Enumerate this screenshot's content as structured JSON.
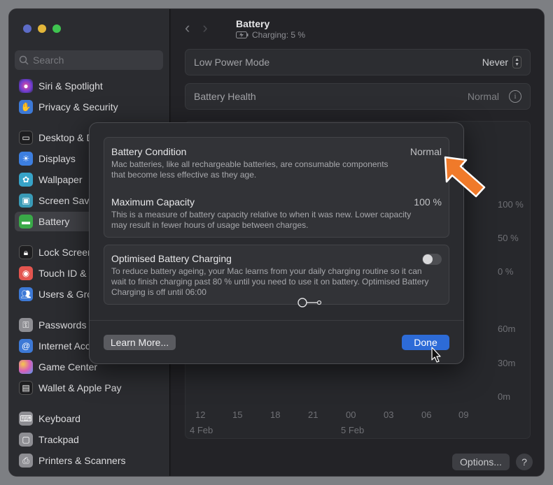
{
  "sidebar": {
    "search_placeholder": "Search",
    "items": [
      {
        "label": "Siri & Spotlight",
        "icon": "siri-icon",
        "color": "#7b3fd1"
      },
      {
        "label": "Privacy & Security",
        "icon": "hand-icon",
        "color": "#3d79d6"
      },
      {
        "label": "Desktop & Dock",
        "icon": "dock-icon",
        "color": "#1e1e20"
      },
      {
        "label": "Displays",
        "icon": "sun-icon",
        "color": "#3d7fe0"
      },
      {
        "label": "Wallpaper",
        "icon": "flower-icon",
        "color": "#37a3c8"
      },
      {
        "label": "Screen Saver",
        "icon": "screensaver-icon",
        "color": "#3a9bb7"
      },
      {
        "label": "Battery",
        "icon": "battery-icon",
        "color": "#39a948"
      },
      {
        "label": "Lock Screen",
        "icon": "lock-icon",
        "color": "#1e1e20"
      },
      {
        "label": "Touch ID & Password",
        "icon": "fingerprint-icon",
        "color": "#e3554f"
      },
      {
        "label": "Users & Groups",
        "icon": "users-icon",
        "color": "#3d79d6"
      },
      {
        "label": "Passwords",
        "icon": "key-icon",
        "color": "#8e8e93"
      },
      {
        "label": "Internet Accounts",
        "icon": "at-icon",
        "color": "#3d79d6"
      },
      {
        "label": "Game Center",
        "icon": "gamecenter-icon",
        "color": "#d95fb7"
      },
      {
        "label": "Wallet & Apple Pay",
        "icon": "wallet-icon",
        "color": "#1e1e20"
      },
      {
        "label": "Keyboard",
        "icon": "keyboard-icon",
        "color": "#8e8e93"
      },
      {
        "label": "Trackpad",
        "icon": "trackpad-icon",
        "color": "#8e8e93"
      },
      {
        "label": "Printers & Scanners",
        "icon": "printer-icon",
        "color": "#8e8e93"
      }
    ]
  },
  "header": {
    "title": "Battery",
    "subtitle": "Charging: 5 %"
  },
  "settings": {
    "low_power_label": "Low Power Mode",
    "low_power_value": "Never",
    "health_label": "Battery Health",
    "health_value": "Normal"
  },
  "chart": {
    "y_ticks_percent": [
      "100 %",
      "50 %",
      "0 %"
    ],
    "y_ticks_time": [
      "60m",
      "30m",
      "0m"
    ],
    "x_ticks": [
      "12",
      "15",
      "18",
      "21",
      "00",
      "03",
      "06",
      "09"
    ],
    "dates": [
      "4 Feb",
      "5 Feb"
    ]
  },
  "footer": {
    "options_label": "Options...",
    "help_label": "?"
  },
  "modal": {
    "condition_title": "Battery Condition",
    "condition_value": "Normal",
    "condition_desc": "Mac batteries, like all rechargeable batteries, are consumable components that become less effective as they age.",
    "capacity_title": "Maximum Capacity",
    "capacity_value": "100 %",
    "capacity_desc": "This is a measure of battery capacity relative to when it was new. Lower capacity may result in fewer hours of usage between charges.",
    "optimised_title": "Optimised Battery Charging",
    "optimised_desc": "To reduce battery ageing, your Mac learns from your daily charging routine so it can wait to finish charging past 80 % until you need to use it on battery. Optimised Battery Charging is off until 06:00",
    "learn_more_label": "Learn More...",
    "done_label": "Done"
  },
  "colors": {
    "accent": "#2d6bd7",
    "arrow": "#f07a2a",
    "traffic_red": "#5d6cc7",
    "traffic_yellow": "#e3b63a",
    "traffic_green": "#3fc450"
  }
}
